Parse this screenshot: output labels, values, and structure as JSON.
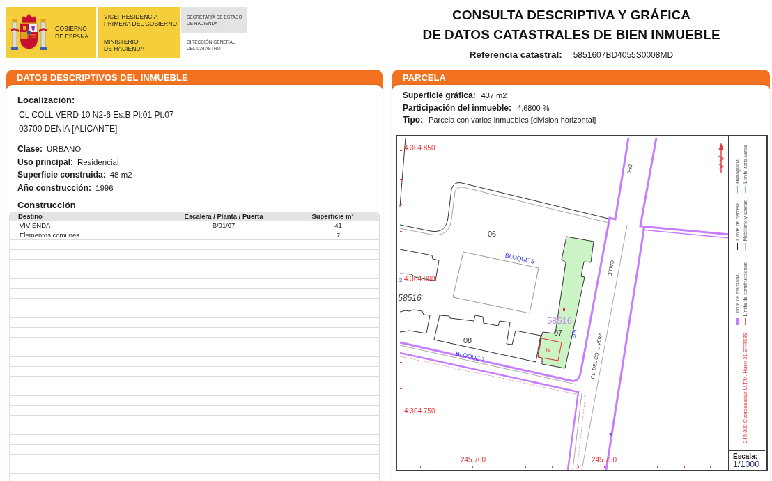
{
  "header": {
    "emblem": {
      "lines": [
        "GOBIERNO",
        "DE ESPAÑA"
      ]
    },
    "ministry": [
      {
        "lines": [
          "VICEPRESIDENCIA",
          "PRIMERA DEL GOBIERNO"
        ]
      },
      {
        "lines": [
          "MINISTERIO",
          "DE HACIENDA"
        ]
      }
    ],
    "agency": [
      {
        "lines": [
          "SECRETARÍA DE ESTADO",
          "DE HACIENDA"
        ]
      },
      {
        "lines": [
          "DIRECCIÓN GENERAL",
          "DEL CATASTRO"
        ]
      }
    ],
    "title": [
      "CONSULTA DESCRIPTIVA Y GRÁFICA",
      "DE DATOS CATASTRALES DE BIEN INMUEBLE"
    ],
    "reference": {
      "label": "Referencia catastral:",
      "value": "5851607BD4055S0008MD"
    }
  },
  "descriptive_panel": {
    "title": "DATOS DESCRIPTIVOS DEL INMUEBLE",
    "location": {
      "label": "Localización:",
      "lines": [
        "CL COLL VERD 10 N2-6 Es:B Pl:01 Pt:07",
        "03700 DENIA [ALICANTE]"
      ]
    },
    "fields": [
      {
        "label": "Clase:",
        "value": "URBANO"
      },
      {
        "label": "Uso principal:",
        "value": "Residencial"
      },
      {
        "label": "Superficie construida:",
        "value": "48 m2"
      },
      {
        "label": "Año construcción:",
        "value": "1996"
      }
    ],
    "construction": {
      "title": "Construcción",
      "columns": [
        "Destino",
        "Escalera / Planta / Puerta",
        "Superficie m²"
      ],
      "rows": [
        {
          "destination": "VIVIENDA",
          "stair_floor_door": "B/01/07",
          "area": "41"
        },
        {
          "destination": "Elementos comunes",
          "area": "7"
        }
      ]
    }
  },
  "parcel_panel": {
    "title": "PARCELA",
    "fields": [
      {
        "label": "Superficie gráfica:",
        "value": "437 m2"
      },
      {
        "label": "Participación del inmueble:",
        "value": "4,6800 %"
      },
      {
        "label": "Tipo:",
        "value": "Parcela con varios inmuebles [division horizontal]"
      }
    ],
    "map_labels": [
      {
        "text": "4.304.850",
        "kind": "coordinate"
      },
      {
        "text": "DEL",
        "kind": "street"
      },
      {
        "text": "06",
        "kind": "plot"
      },
      {
        "text": "BLOQUE 5",
        "kind": "block"
      },
      {
        "text": "CALLE",
        "kind": "street"
      },
      {
        "text": "3",
        "kind": "number"
      },
      {
        "text": "4.304.800",
        "kind": "coordinate"
      },
      {
        "text": "58516",
        "kind": "parcel"
      },
      {
        "text": "58516",
        "kind": "selected_parcel"
      },
      {
        "text": "07",
        "kind": "plot"
      },
      {
        "text": "S/N",
        "kind": "number"
      },
      {
        "text": "08",
        "kind": "plot"
      },
      {
        "text": "IV",
        "kind": "floor"
      },
      {
        "text": "BLOQUE 7",
        "kind": "block"
      },
      {
        "text": "CL. DEL COLL-VERA",
        "kind": "street"
      },
      {
        "text": "4.304.750",
        "kind": "coordinate"
      },
      {
        "text": "3",
        "kind": "number"
      },
      {
        "text": "245.700",
        "kind": "coordinate"
      },
      {
        "text": "245.750",
        "kind": "coordinate"
      }
    ],
    "legend": [
      {
        "label": "Límite de manzana",
        "color": "#c77dff",
        "kind": "band"
      },
      {
        "label": "Límite de construcciones",
        "color": "#ff5a5a",
        "kind": "line"
      },
      {
        "label": "Límite de parcela",
        "color": "#222222",
        "kind": "line"
      },
      {
        "label": "Mobiliario y aceras",
        "color": "#bbbbbb",
        "kind": "line"
      },
      {
        "label": "Hidrografía",
        "color": "#8aa0ff",
        "kind": "line"
      },
      {
        "label": "Límite zona verde",
        "color": "#7ddc8a",
        "kind": "line"
      }
    ],
    "coordinate_note": "245.800 Coordenadas U.T.M. Huso 31 ETRS89",
    "scale": {
      "label": "Escala:",
      "value": "1/1000"
    }
  }
}
